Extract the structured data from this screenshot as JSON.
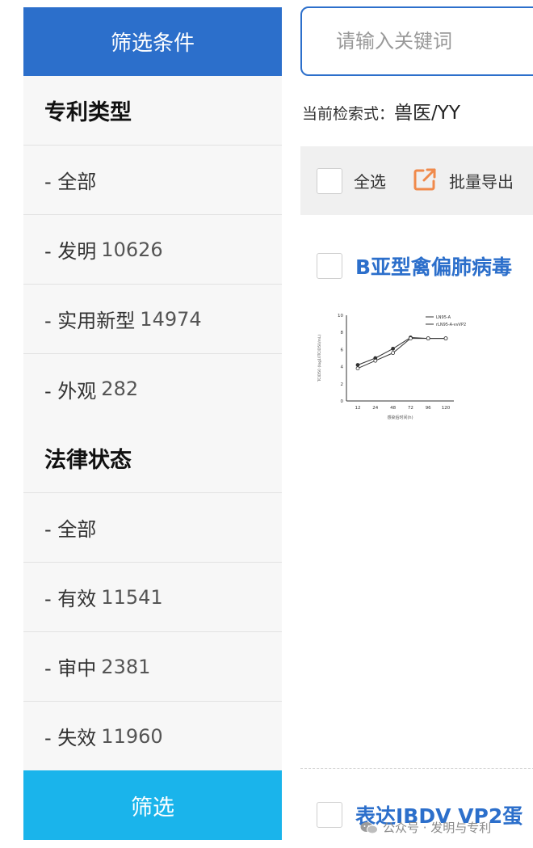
{
  "sidebar": {
    "header": "筛选条件",
    "groups": [
      {
        "title": "专利类型",
        "items": [
          {
            "label": "- 全部",
            "count": ""
          },
          {
            "label": "- 发明",
            "count": "10626"
          },
          {
            "label": "- 实用新型",
            "count": "14974"
          },
          {
            "label": "- 外观",
            "count": "282"
          }
        ]
      },
      {
        "title": "法律状态",
        "items": [
          {
            "label": "- 全部",
            "count": ""
          },
          {
            "label": "- 有效",
            "count": "11541"
          },
          {
            "label": "- 审中",
            "count": "2381"
          },
          {
            "label": "- 失效",
            "count": "11960"
          }
        ]
      }
    ],
    "filter_button": "筛选"
  },
  "search": {
    "placeholder": "请输入关键词",
    "value": ""
  },
  "query": {
    "label": "当前检索式：",
    "value": "兽医/YY"
  },
  "toolbar": {
    "select_all": "全选",
    "export": "批量导出"
  },
  "results": [
    {
      "title": "B亚型禽偏肺病毒"
    },
    {
      "title": "表达IBDV VP2蛋"
    }
  ],
  "thumbnail_chart": {
    "x_ticks": [
      "12",
      "24",
      "48",
      "72",
      "96",
      "120"
    ],
    "y_ticks": [
      "0",
      "2",
      "4",
      "6",
      "8",
      "10"
    ],
    "legend": [
      "LN95-A",
      "rLN95-A-vvVP2"
    ],
    "ylabel": "TCID50 (log10TCID50/mL)",
    "xlabel": "感染后时间(h)"
  },
  "watermark": "公众号 · 发明与专利",
  "colors": {
    "primary": "#2c6fcb",
    "filter_button": "#1ab4eb",
    "export_icon": "#f08a4b"
  }
}
